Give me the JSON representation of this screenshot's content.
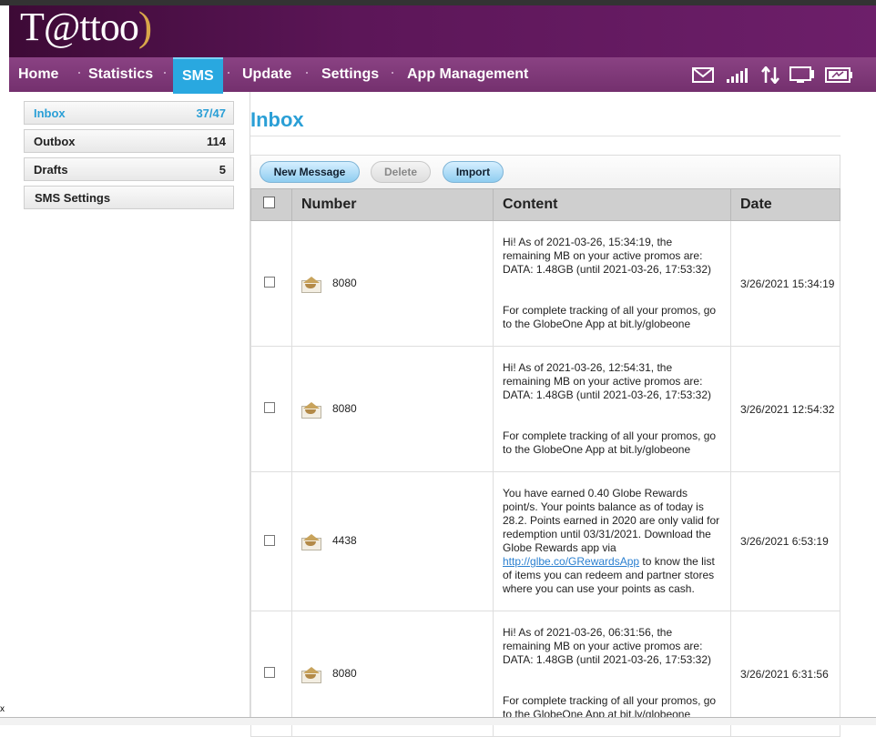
{
  "header": {
    "logo_text": "T@ttoo"
  },
  "nav": {
    "items": [
      {
        "label": "Home"
      },
      {
        "label": "Statistics"
      },
      {
        "label": "SMS"
      },
      {
        "label": "Update"
      },
      {
        "label": "Settings"
      },
      {
        "label": "App Management"
      }
    ],
    "active": "SMS"
  },
  "sidebar": {
    "items": [
      {
        "label": "Inbox",
        "count": "37/47"
      },
      {
        "label": "Outbox",
        "count": "114"
      },
      {
        "label": "Drafts",
        "count": "5"
      },
      {
        "label": "SMS Settings",
        "count": ""
      }
    ]
  },
  "page": {
    "title": "Inbox"
  },
  "toolbar": {
    "new_message": "New Message",
    "delete": "Delete",
    "import": "Import"
  },
  "table": {
    "headers": {
      "number": "Number",
      "content": "Content",
      "date": "Date"
    },
    "rows": [
      {
        "number": "8080",
        "content_lines": [
          "Hi! As of 2021-03-26, 15:34:19, the remaining MB on your active promos are:",
          "DATA: 1.48GB (until 2021-03-26, 17:53:32)",
          "",
          "",
          "For complete tracking of all your promos, go to the GlobeOne App at bit.ly/globeone"
        ],
        "date": "3/26/2021 15:34:19"
      },
      {
        "number": "8080",
        "content_lines": [
          "Hi! As of 2021-03-26, 12:54:31, the remaining MB on your active promos are:",
          "DATA: 1.48GB (until 2021-03-26, 17:53:32)",
          "",
          "",
          "For complete tracking of all your promos, go to the GlobeOne App at bit.ly/globeone"
        ],
        "date": "3/26/2021 12:54:32"
      },
      {
        "number": "4438",
        "content_pre": "You have earned 0.40 Globe Rewards point/s. Your points balance as of today is 28.2. Points earned in 2020 are only valid for redemption until 03/31/2021. Download the Globe Rewards app via ",
        "content_link": "http://glbe.co/GRewardsApp",
        "content_post": " to know the list of items you can redeem and partner stores where you can use your points as cash.",
        "date": "3/26/2021 6:53:19"
      },
      {
        "number": "8080",
        "content_lines": [
          "Hi! As of 2021-03-26, 06:31:56, the remaining MB on your active promos are:",
          "DATA: 1.48GB (until 2021-03-26, 17:53:32)",
          "",
          "",
          "For complete tracking of all your promos, go to the GlobeOne App at bit.ly/globeone"
        ],
        "date": "3/26/2021 6:31:56"
      }
    ]
  },
  "icons": {
    "status": [
      "mail-icon",
      "signal-bars-icon",
      "data-transfer-icon",
      "monitor-icon",
      "battery-icon"
    ],
    "row": "envelope-icon"
  },
  "colors": {
    "accent": "#2a9fd6",
    "header_purple": "#5c1658",
    "nav_purple": "#7a3574"
  },
  "misc": {
    "close_glyph": "x"
  }
}
